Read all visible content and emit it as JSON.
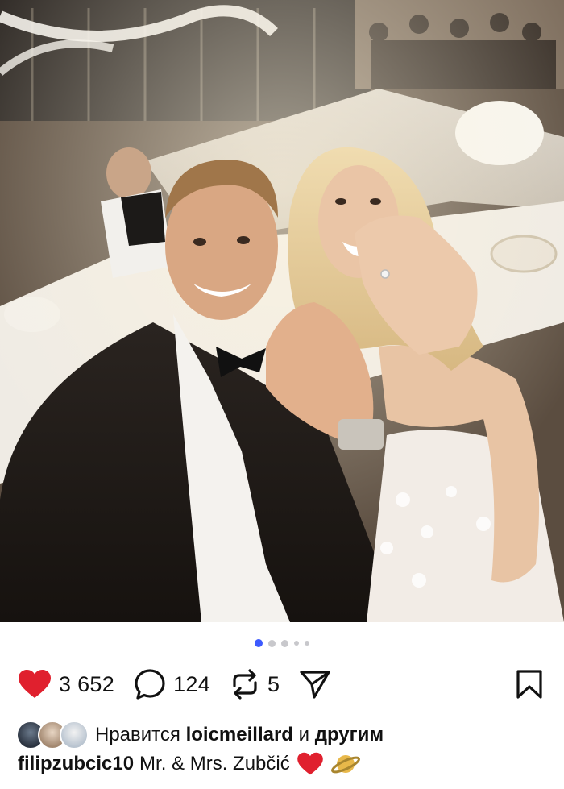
{
  "post": {
    "image_alt": "Selfie of a couple showing wedding rings at a wedding reception",
    "carousel": {
      "count": 5,
      "active_index": 0
    }
  },
  "actions": {
    "likes_count": "3 652",
    "comments_count": "124",
    "reposts_count": "5"
  },
  "liked_by": {
    "prefix": "Нравится",
    "user": "loicmeillard",
    "connector": "и",
    "others": "другим"
  },
  "caption": {
    "username": "filipzubcic10",
    "text": "Mr. & Mrs. Zubčić"
  },
  "colors": {
    "like_red": "#e0202e",
    "carousel_active": "#3d5afe"
  }
}
